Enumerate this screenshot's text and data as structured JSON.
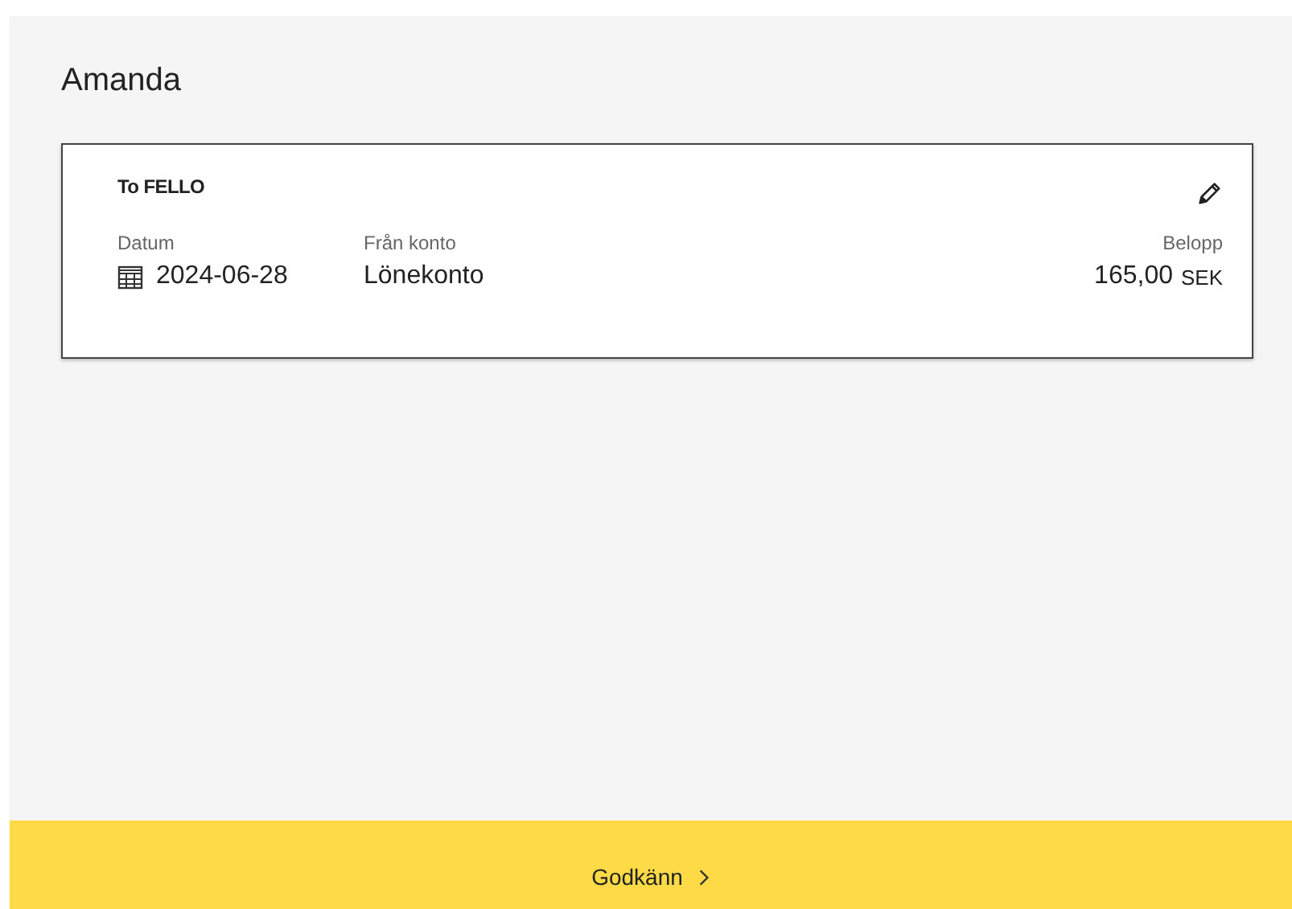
{
  "header": {
    "name": "Amanda"
  },
  "payment": {
    "recipient": "To FELLO",
    "fields": [
      {
        "kind": "date",
        "label": "Datum",
        "value": "2024-06-28"
      },
      {
        "kind": "text",
        "label": "Från konto",
        "value": "Lönekonto"
      },
      {
        "kind": "amount",
        "label": "Belopp",
        "value": "165,00",
        "currency": "SEK"
      }
    ]
  },
  "footer": {
    "button": "Godkänn"
  }
}
